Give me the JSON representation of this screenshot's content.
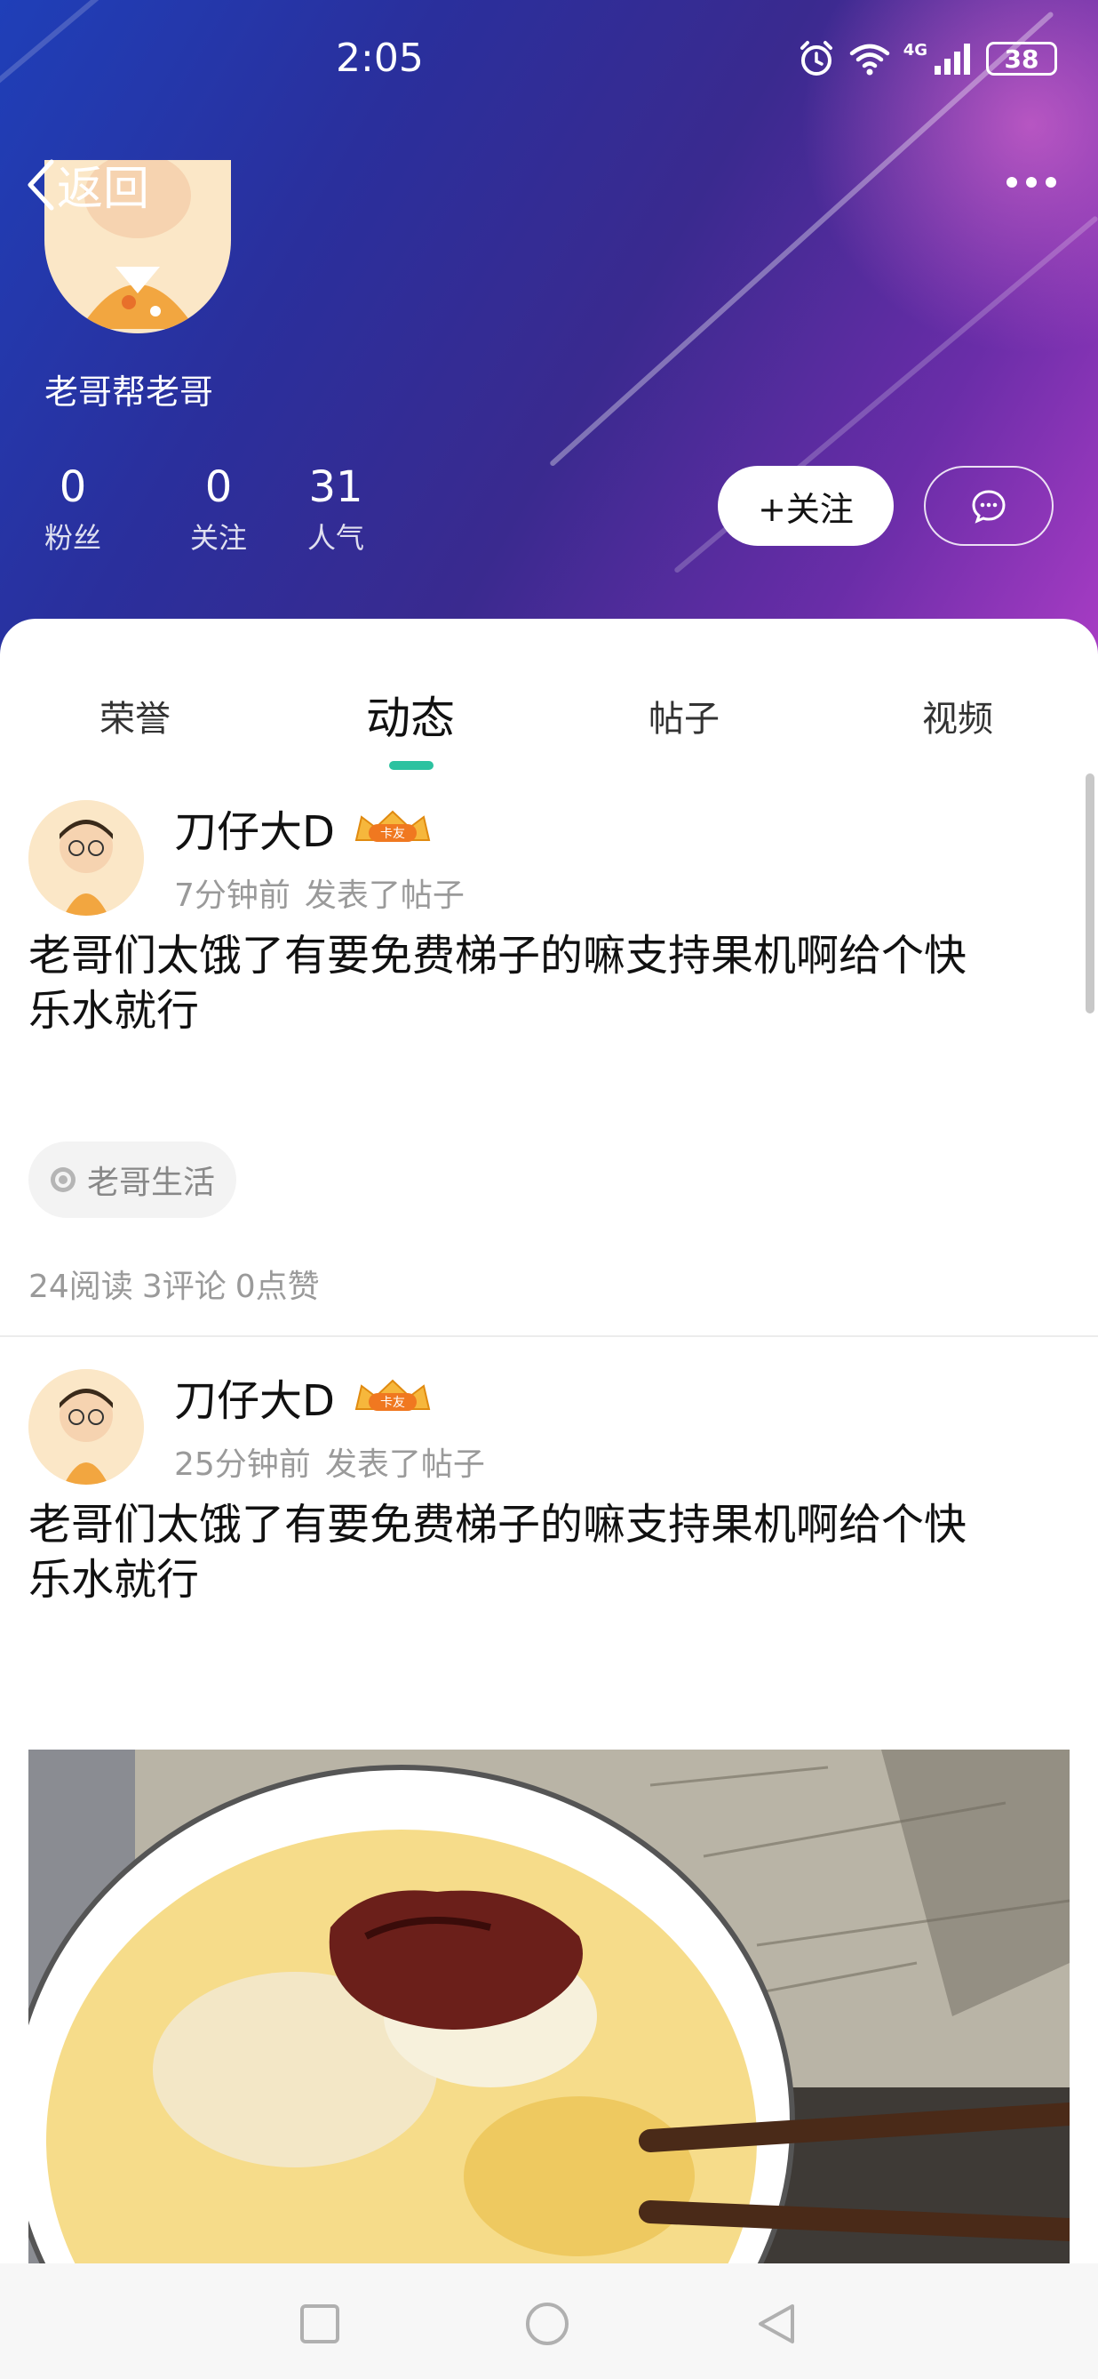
{
  "status_bar": {
    "time": "2:05",
    "network": "4G",
    "battery": "38"
  },
  "header": {
    "back_label": "返回",
    "username": "老哥帮老哥",
    "stats": [
      {
        "value": "0",
        "label": "粉丝"
      },
      {
        "value": "0",
        "label": "关注"
      },
      {
        "value": "31",
        "label": "人气"
      }
    ],
    "follow_label": "+关注"
  },
  "tabs": [
    {
      "label": "荣誉",
      "active": false
    },
    {
      "label": "动态",
      "active": true
    },
    {
      "label": "帖子",
      "active": false
    },
    {
      "label": "视频",
      "active": false
    }
  ],
  "colors": {
    "accent": "#2cc2a0",
    "badge": "#f0a020"
  },
  "posts": [
    {
      "author": "刀仔大D",
      "badge": "卡友",
      "time": "7分钟前",
      "action": "发表了帖子",
      "text_line1": "老哥们太饿了有要免费梯子的嘛支持果机啊给个快",
      "text_line2": "乐水就行",
      "topic": "老哥生活",
      "stats": {
        "reads": "24阅读",
        "comments": "3评论",
        "likes": "0点赞"
      }
    },
    {
      "author": "刀仔大D",
      "badge": "卡友",
      "time": "25分钟前",
      "action": "发表了帖子",
      "text_line1": "老哥们太饿了有要免费梯子的嘛支持果机啊给个快",
      "text_line2": "乐水就行"
    }
  ]
}
